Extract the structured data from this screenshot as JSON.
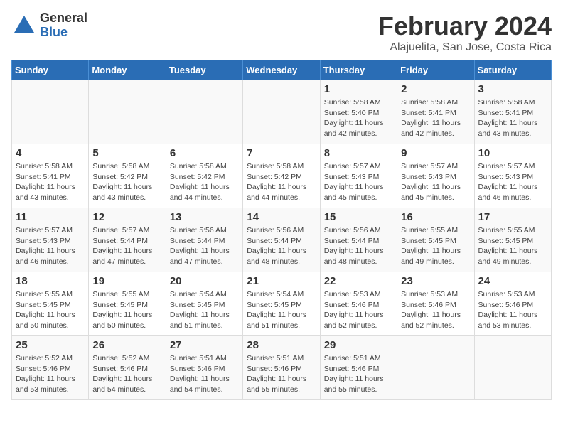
{
  "logo": {
    "general": "General",
    "blue": "Blue"
  },
  "title": "February 2024",
  "location": "Alajuelita, San Jose, Costa Rica",
  "weekdays": [
    "Sunday",
    "Monday",
    "Tuesday",
    "Wednesday",
    "Thursday",
    "Friday",
    "Saturday"
  ],
  "weeks": [
    [
      {
        "day": "",
        "info": ""
      },
      {
        "day": "",
        "info": ""
      },
      {
        "day": "",
        "info": ""
      },
      {
        "day": "",
        "info": ""
      },
      {
        "day": "1",
        "info": "Sunrise: 5:58 AM\nSunset: 5:40 PM\nDaylight: 11 hours\nand 42 minutes."
      },
      {
        "day": "2",
        "info": "Sunrise: 5:58 AM\nSunset: 5:41 PM\nDaylight: 11 hours\nand 42 minutes."
      },
      {
        "day": "3",
        "info": "Sunrise: 5:58 AM\nSunset: 5:41 PM\nDaylight: 11 hours\nand 43 minutes."
      }
    ],
    [
      {
        "day": "4",
        "info": "Sunrise: 5:58 AM\nSunset: 5:41 PM\nDaylight: 11 hours\nand 43 minutes."
      },
      {
        "day": "5",
        "info": "Sunrise: 5:58 AM\nSunset: 5:42 PM\nDaylight: 11 hours\nand 43 minutes."
      },
      {
        "day": "6",
        "info": "Sunrise: 5:58 AM\nSunset: 5:42 PM\nDaylight: 11 hours\nand 44 minutes."
      },
      {
        "day": "7",
        "info": "Sunrise: 5:58 AM\nSunset: 5:42 PM\nDaylight: 11 hours\nand 44 minutes."
      },
      {
        "day": "8",
        "info": "Sunrise: 5:57 AM\nSunset: 5:43 PM\nDaylight: 11 hours\nand 45 minutes."
      },
      {
        "day": "9",
        "info": "Sunrise: 5:57 AM\nSunset: 5:43 PM\nDaylight: 11 hours\nand 45 minutes."
      },
      {
        "day": "10",
        "info": "Sunrise: 5:57 AM\nSunset: 5:43 PM\nDaylight: 11 hours\nand 46 minutes."
      }
    ],
    [
      {
        "day": "11",
        "info": "Sunrise: 5:57 AM\nSunset: 5:43 PM\nDaylight: 11 hours\nand 46 minutes."
      },
      {
        "day": "12",
        "info": "Sunrise: 5:57 AM\nSunset: 5:44 PM\nDaylight: 11 hours\nand 47 minutes."
      },
      {
        "day": "13",
        "info": "Sunrise: 5:56 AM\nSunset: 5:44 PM\nDaylight: 11 hours\nand 47 minutes."
      },
      {
        "day": "14",
        "info": "Sunrise: 5:56 AM\nSunset: 5:44 PM\nDaylight: 11 hours\nand 48 minutes."
      },
      {
        "day": "15",
        "info": "Sunrise: 5:56 AM\nSunset: 5:44 PM\nDaylight: 11 hours\nand 48 minutes."
      },
      {
        "day": "16",
        "info": "Sunrise: 5:55 AM\nSunset: 5:45 PM\nDaylight: 11 hours\nand 49 minutes."
      },
      {
        "day": "17",
        "info": "Sunrise: 5:55 AM\nSunset: 5:45 PM\nDaylight: 11 hours\nand 49 minutes."
      }
    ],
    [
      {
        "day": "18",
        "info": "Sunrise: 5:55 AM\nSunset: 5:45 PM\nDaylight: 11 hours\nand 50 minutes."
      },
      {
        "day": "19",
        "info": "Sunrise: 5:55 AM\nSunset: 5:45 PM\nDaylight: 11 hours\nand 50 minutes."
      },
      {
        "day": "20",
        "info": "Sunrise: 5:54 AM\nSunset: 5:45 PM\nDaylight: 11 hours\nand 51 minutes."
      },
      {
        "day": "21",
        "info": "Sunrise: 5:54 AM\nSunset: 5:45 PM\nDaylight: 11 hours\nand 51 minutes."
      },
      {
        "day": "22",
        "info": "Sunrise: 5:53 AM\nSunset: 5:46 PM\nDaylight: 11 hours\nand 52 minutes."
      },
      {
        "day": "23",
        "info": "Sunrise: 5:53 AM\nSunset: 5:46 PM\nDaylight: 11 hours\nand 52 minutes."
      },
      {
        "day": "24",
        "info": "Sunrise: 5:53 AM\nSunset: 5:46 PM\nDaylight: 11 hours\nand 53 minutes."
      }
    ],
    [
      {
        "day": "25",
        "info": "Sunrise: 5:52 AM\nSunset: 5:46 PM\nDaylight: 11 hours\nand 53 minutes."
      },
      {
        "day": "26",
        "info": "Sunrise: 5:52 AM\nSunset: 5:46 PM\nDaylight: 11 hours\nand 54 minutes."
      },
      {
        "day": "27",
        "info": "Sunrise: 5:51 AM\nSunset: 5:46 PM\nDaylight: 11 hours\nand 54 minutes."
      },
      {
        "day": "28",
        "info": "Sunrise: 5:51 AM\nSunset: 5:46 PM\nDaylight: 11 hours\nand 55 minutes."
      },
      {
        "day": "29",
        "info": "Sunrise: 5:51 AM\nSunset: 5:46 PM\nDaylight: 11 hours\nand 55 minutes."
      },
      {
        "day": "",
        "info": ""
      },
      {
        "day": "",
        "info": ""
      }
    ]
  ]
}
